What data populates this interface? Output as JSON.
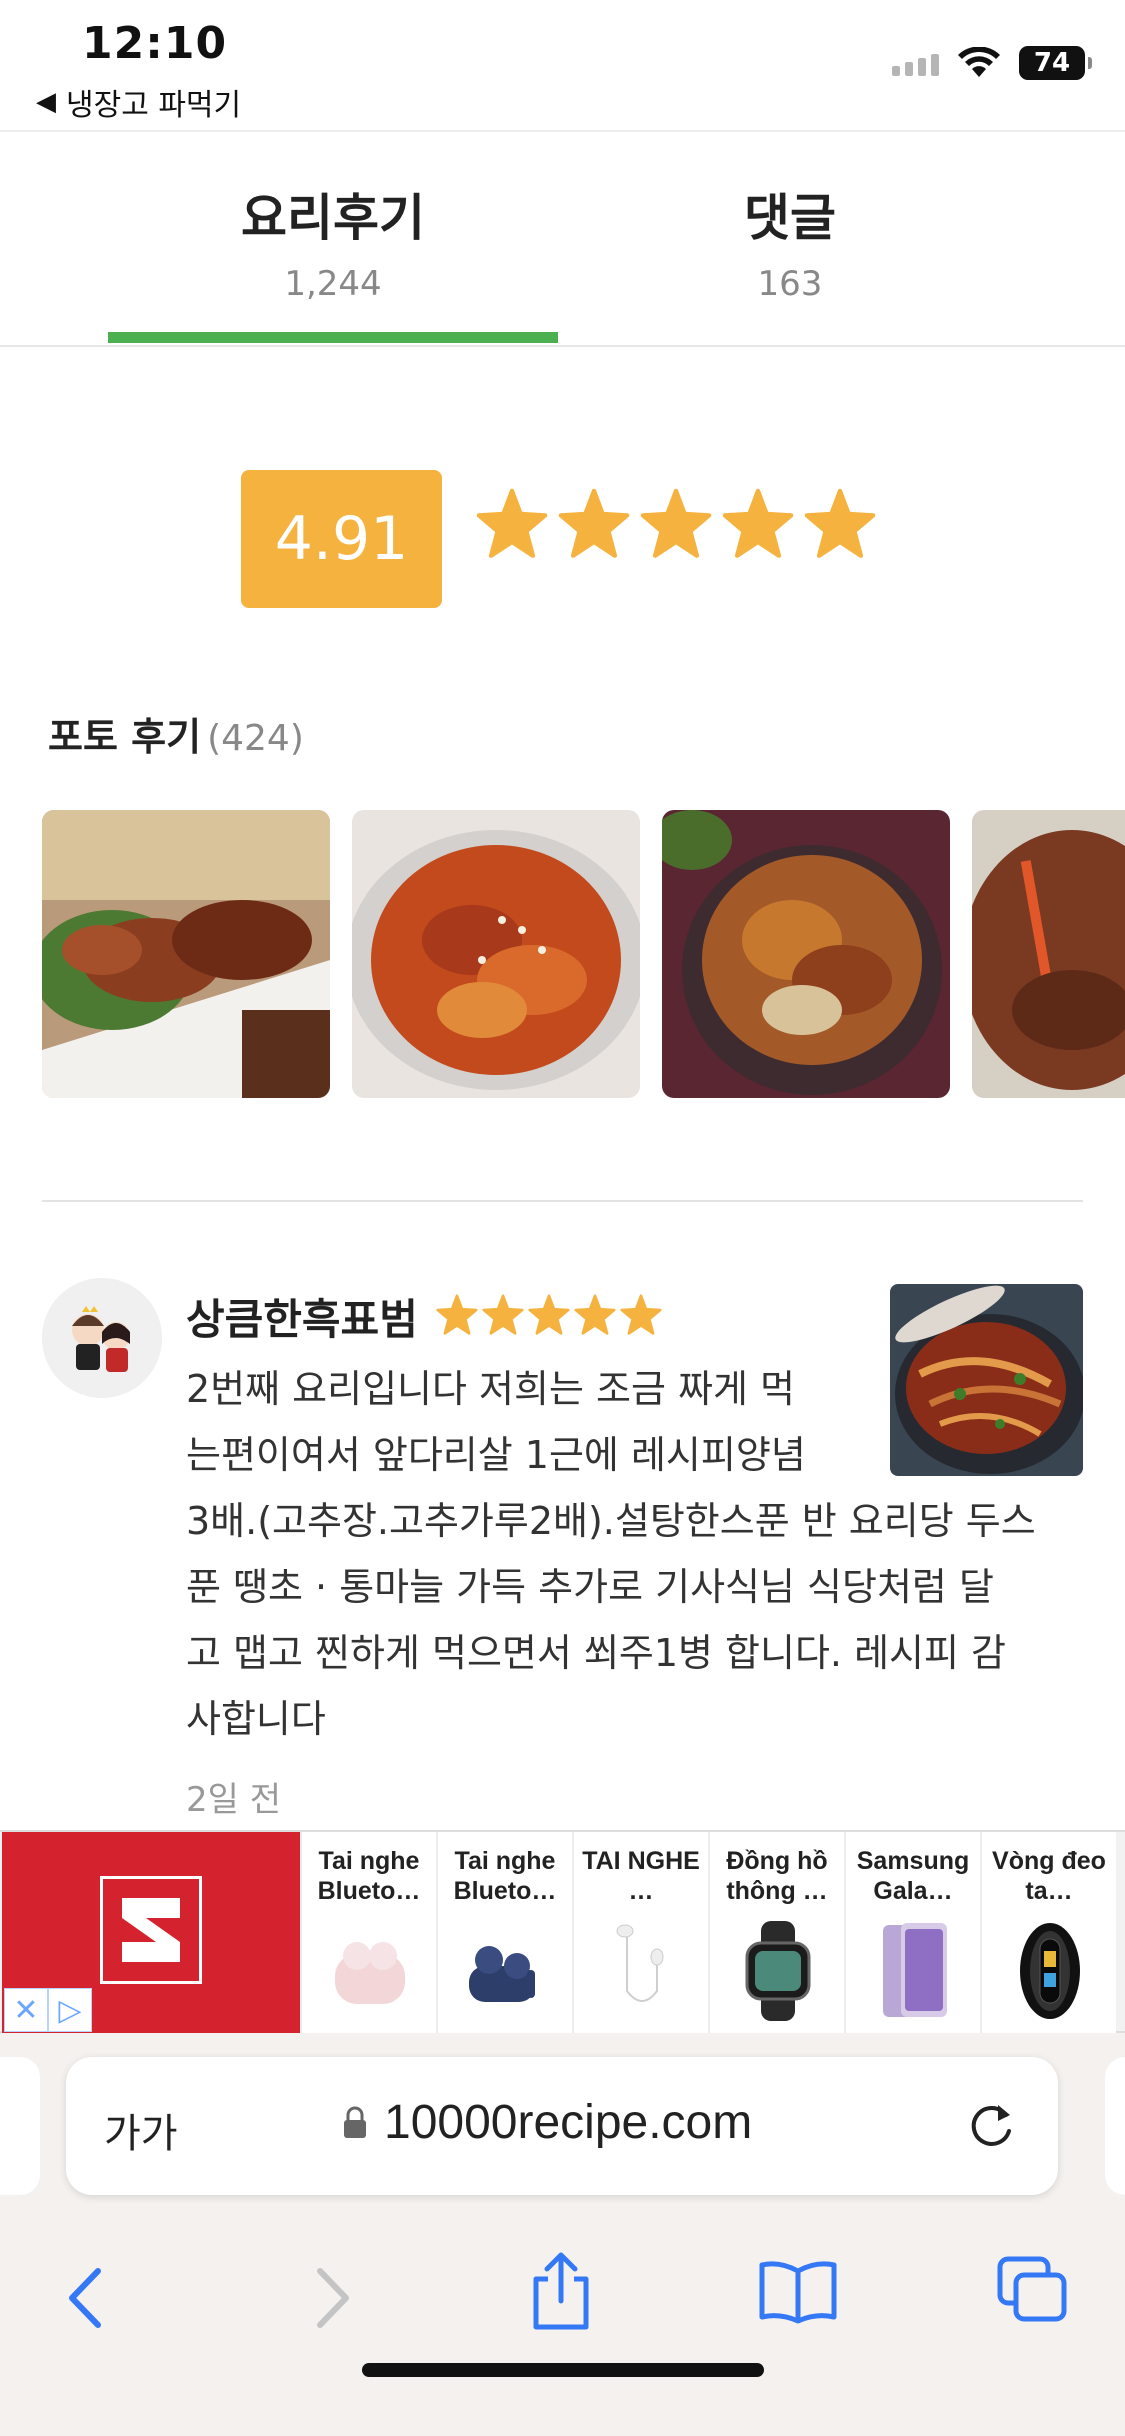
{
  "status_bar": {
    "time": "12:10",
    "back_app": "냉장고 파먹기",
    "battery": "74"
  },
  "tabs": [
    {
      "title": "요리후기",
      "count": "1,244",
      "active": true
    },
    {
      "title": "댓글",
      "count": "163",
      "active": false
    }
  ],
  "rating": {
    "score": "4.91",
    "stars": 5,
    "star_color": "#f5b23e"
  },
  "photo_reviews": {
    "title": "포토 후기",
    "count": "(424)"
  },
  "review": {
    "author": "상큼한흑표범",
    "stars": 5,
    "text_lines": [
      "2번째 요리입니다 저희는 조금 짜게 먹",
      "는편이여서 앞다리살 1근에 레시피양념",
      "3배.(고추장.고추가루2배).설탕한스푼 반 요리당 두스",
      "푼 땡초 · 통마늘 가득 추가로 기사식님 식당처럼 달",
      "고 맵고 찐하게 먹으면서 쐬주1병 합니다. 레시피 감",
      "사합니다"
    ],
    "time": "2일 전"
  },
  "ad": {
    "brand_color": "#d4232e",
    "items": [
      {
        "title": "Tai nghe Blueto…",
        "icon": "earbuds-pink-icon"
      },
      {
        "title": "Tai nghe Blueto…",
        "icon": "earbuds-navy-icon"
      },
      {
        "title": "TAI NGHE …",
        "icon": "wired-earphones-icon"
      },
      {
        "title": "Đồng hồ thông …",
        "icon": "smartwatch-icon"
      },
      {
        "title": "Samsung Gala…",
        "icon": "phone-icon"
      },
      {
        "title": "Vòng đeo ta…",
        "icon": "fitness-band-icon"
      }
    ]
  },
  "browser": {
    "text_size_label": "가가",
    "url": "10000recipe.com"
  },
  "colors": {
    "accent_green": "#4caf50",
    "ios_blue": "#3478f6"
  }
}
